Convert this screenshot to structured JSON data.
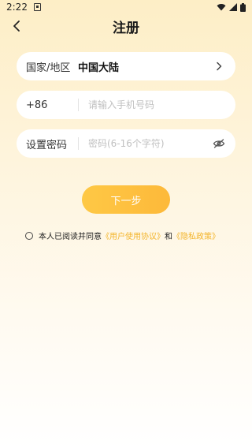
{
  "status_bar": {
    "time": "2:22"
  },
  "header": {
    "title": "注册",
    "back_icon": "chevron-left-icon"
  },
  "form": {
    "region": {
      "label": "国家/地区",
      "value": "中国大陆",
      "icon": "chevron-right-icon"
    },
    "phone": {
      "prefix": "+86",
      "value": "",
      "placeholder": "请输入手机号码"
    },
    "password": {
      "label": "设置密码",
      "value": "",
      "placeholder": "密码(6-16个字符)",
      "icon": "eye-off-icon"
    }
  },
  "next_button": {
    "label": "下一步"
  },
  "agreement": {
    "prefix": "本人已阅读并同意",
    "user_agreement": "《用户使用协议》",
    "conjunction": "和",
    "privacy_policy": "《隐私政策》"
  },
  "colors": {
    "accent": "#fdbf3f",
    "link": "#f3b52c",
    "background_top": "#fdeec6",
    "background_bottom": "#ffffff"
  }
}
